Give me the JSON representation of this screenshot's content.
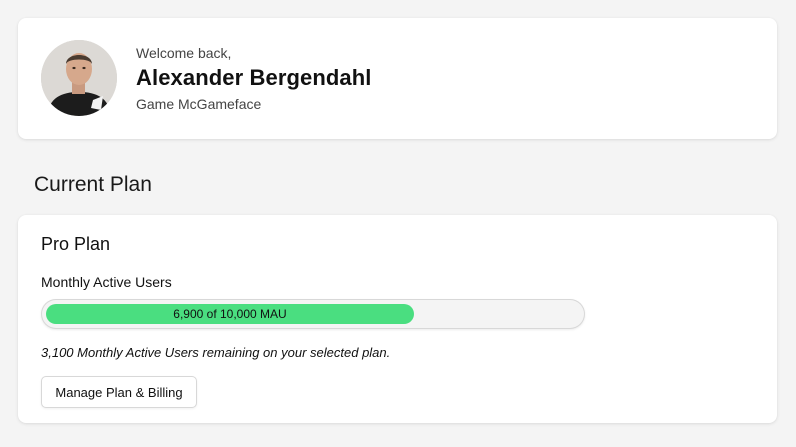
{
  "profile": {
    "greeting": "Welcome back,",
    "name": "Alexander Bergendahl",
    "organization": "Game McGameface"
  },
  "current_plan": {
    "section_title": "Current Plan",
    "plan_name": "Pro Plan",
    "metric_label": "Monthly Active Users",
    "usage": {
      "used": 6900,
      "limit": 10000,
      "label": "6,900 of 10,000 MAU",
      "fill_color": "#4ade80"
    },
    "remaining_note": "3,100 Monthly Active Users remaining on your selected plan.",
    "manage_button_label": "Manage Plan & Billing"
  }
}
